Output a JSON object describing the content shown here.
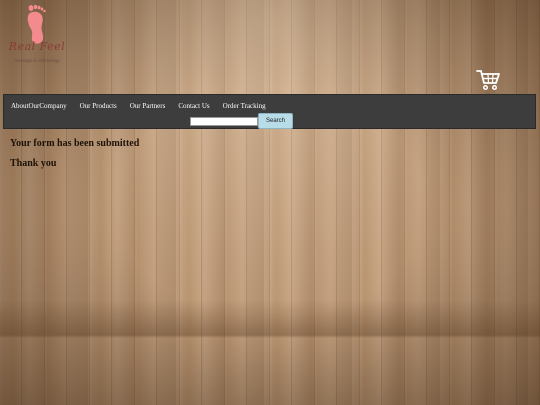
{
  "brand": {
    "script_text": "Real Feel",
    "tagline": "massage & reflexology"
  },
  "nav": {
    "items": [
      {
        "label": "AboutOurCompany"
      },
      {
        "label": "Our Products"
      },
      {
        "label": "Our Partners"
      },
      {
        "label": "Contact Us"
      },
      {
        "label": "Order Tracking"
      }
    ]
  },
  "search": {
    "value": "",
    "placeholder": "",
    "button_label": "Search"
  },
  "main": {
    "submitted_message": "Your form has been submitted",
    "thanks_message": "Thank you"
  },
  "colors": {
    "navbar": "#3d3d3d",
    "search_button": "#b9dce9",
    "logo_foot": "#f28a8e",
    "wood": "#b99571"
  },
  "icons": {
    "logo": "foot-icon",
    "cart": "shopping-cart-icon"
  }
}
